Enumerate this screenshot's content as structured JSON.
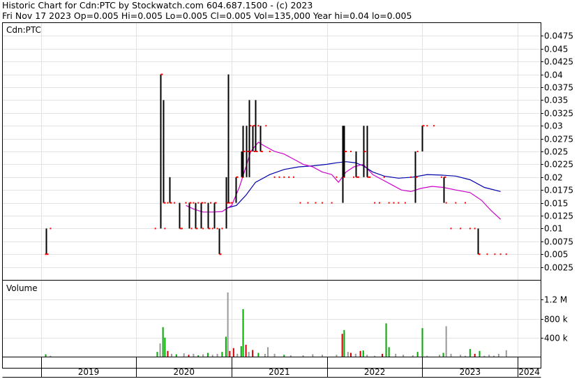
{
  "header": {
    "line1": "Historic Chart for Cdn:PTC by Stockwatch.com 604.687.1500 - (c) 2023",
    "line2": "Fri Nov 17 2023   Op=0.005  Hi=0.005  Lo=0.005  Cl=0.005  Vol=135,000  Year hi=0.04  lo=0.005"
  },
  "chart_data": [
    {
      "type": "line",
      "title": "Cdn:PTC",
      "xlabel": "",
      "ylabel": "",
      "x_tick_labels": [
        "2019",
        "2020",
        "2021",
        "2022",
        "2023",
        "2024"
      ],
      "y_tick_labels": [
        "0.0475",
        "0.045",
        "0.0425",
        "0.04",
        "0.0375",
        "0.035",
        "0.0325",
        "0.03",
        "0.0275",
        "0.025",
        "0.0225",
        "0.02",
        "0.0175",
        "0.015",
        "0.0125",
        "0.01",
        "0.0075",
        "0.005",
        "0.0025"
      ],
      "ylim": [
        0,
        0.05
      ],
      "xlim": [
        2018.6,
        2024.24
      ],
      "grid": true,
      "colors": {
        "price_bar": "#000000",
        "price_close": "#ff0000",
        "ma_short": "#cc00cc",
        "ma_long": "#0000aa"
      },
      "price_bars": [
        [
          2019.05,
          0.005,
          0.01,
          0.005
        ],
        [
          2020.25,
          0.01,
          0.04,
          0.04
        ],
        [
          2020.28,
          0.015,
          0.035,
          0.015
        ],
        [
          2020.35,
          0.015,
          0.02,
          0.015
        ],
        [
          2020.45,
          0.01,
          0.015,
          0.01
        ],
        [
          2020.55,
          0.01,
          0.015,
          0.015
        ],
        [
          2020.62,
          0.01,
          0.015,
          0.01
        ],
        [
          2020.68,
          0.01,
          0.015,
          0.015
        ],
        [
          2020.75,
          0.01,
          0.015,
          0.01
        ],
        [
          2020.82,
          0.01,
          0.015,
          0.015
        ],
        [
          2020.87,
          0.005,
          0.01,
          0.005
        ],
        [
          2020.94,
          0.01,
          0.02,
          0.015
        ],
        [
          2020.96,
          0.015,
          0.04,
          0.015
        ],
        [
          2021.04,
          0.015,
          0.02,
          0.02
        ],
        [
          2021.1,
          0.02,
          0.025,
          0.02
        ],
        [
          2021.12,
          0.02,
          0.03,
          0.025
        ],
        [
          2021.15,
          0.02,
          0.03,
          0.025
        ],
        [
          2021.18,
          0.02,
          0.035,
          0.025
        ],
        [
          2021.22,
          0.025,
          0.03,
          0.03
        ],
        [
          2021.25,
          0.025,
          0.035,
          0.025
        ],
        [
          2021.3,
          0.025,
          0.03,
          0.025
        ],
        [
          2022.16,
          0.015,
          0.03,
          0.02
        ],
        [
          2022.18,
          0.02,
          0.03,
          0.025
        ],
        [
          2022.3,
          0.02,
          0.025,
          0.02
        ],
        [
          2022.38,
          0.02,
          0.03,
          0.025
        ],
        [
          2022.42,
          0.02,
          0.03,
          0.02
        ],
        [
          2022.92,
          0.015,
          0.025,
          0.02
        ],
        [
          2023.0,
          0.025,
          0.03,
          0.03
        ],
        [
          2023.22,
          0.015,
          0.02,
          0.02
        ],
        [
          2023.58,
          0.005,
          0.01,
          0.005
        ]
      ],
      "close_dots": [
        [
          2019.05,
          0.005
        ],
        [
          2019.1,
          0.01
        ],
        [
          2020.2,
          0.01
        ],
        [
          2020.3,
          0.01
        ],
        [
          2020.33,
          0.015
        ],
        [
          2020.4,
          0.015
        ],
        [
          2020.48,
          0.01
        ],
        [
          2020.52,
          0.015
        ],
        [
          2020.58,
          0.01
        ],
        [
          2020.6,
          0.015
        ],
        [
          2020.65,
          0.015
        ],
        [
          2020.7,
          0.01
        ],
        [
          2020.72,
          0.015
        ],
        [
          2020.78,
          0.015
        ],
        [
          2020.8,
          0.01
        ],
        [
          2020.85,
          0.01
        ],
        [
          2020.88,
          0.005
        ],
        [
          2020.9,
          0.01
        ],
        [
          2021.0,
          0.015
        ],
        [
          2021.06,
          0.02
        ],
        [
          2021.13,
          0.025
        ],
        [
          2021.2,
          0.03
        ],
        [
          2021.24,
          0.025
        ],
        [
          2021.28,
          0.03
        ],
        [
          2021.32,
          0.025
        ],
        [
          2021.36,
          0.03
        ],
        [
          2021.4,
          0.025
        ],
        [
          2021.45,
          0.02
        ],
        [
          2021.5,
          0.02
        ],
        [
          2021.55,
          0.02
        ],
        [
          2021.6,
          0.02
        ],
        [
          2021.65,
          0.02
        ],
        [
          2021.72,
          0.015
        ],
        [
          2021.8,
          0.015
        ],
        [
          2021.88,
          0.015
        ],
        [
          2021.95,
          0.015
        ],
        [
          2022.05,
          0.015
        ],
        [
          2022.1,
          0.02
        ],
        [
          2022.2,
          0.025
        ],
        [
          2022.25,
          0.025
        ],
        [
          2022.28,
          0.02
        ],
        [
          2022.33,
          0.02
        ],
        [
          2022.4,
          0.025
        ],
        [
          2022.45,
          0.02
        ],
        [
          2022.5,
          0.015
        ],
        [
          2022.55,
          0.015
        ],
        [
          2022.6,
          0.02
        ],
        [
          2022.65,
          0.015
        ],
        [
          2022.7,
          0.015
        ],
        [
          2022.75,
          0.015
        ],
        [
          2022.82,
          0.015
        ],
        [
          2022.88,
          0.02
        ],
        [
          2022.95,
          0.025
        ],
        [
          2023.05,
          0.03
        ],
        [
          2023.12,
          0.03
        ],
        [
          2023.2,
          0.02
        ],
        [
          2023.25,
          0.015
        ],
        [
          2023.3,
          0.01
        ],
        [
          2023.35,
          0.015
        ],
        [
          2023.4,
          0.01
        ],
        [
          2023.45,
          0.015
        ],
        [
          2023.5,
          0.01
        ],
        [
          2023.55,
          0.01
        ],
        [
          2023.6,
          0.005
        ],
        [
          2023.68,
          0.005
        ],
        [
          2023.76,
          0.005
        ],
        [
          2023.82,
          0.005
        ],
        [
          2023.88,
          0.005
        ]
      ],
      "ma_short": [
        [
          2020.52,
          0.0145
        ],
        [
          2020.6,
          0.0138
        ],
        [
          2020.7,
          0.0132
        ],
        [
          2020.8,
          0.0132
        ],
        [
          2020.9,
          0.0133
        ],
        [
          2021.0,
          0.0145
        ],
        [
          2021.08,
          0.018
        ],
        [
          2021.15,
          0.022
        ],
        [
          2021.2,
          0.025
        ],
        [
          2021.28,
          0.0268
        ],
        [
          2021.35,
          0.026
        ],
        [
          2021.45,
          0.025
        ],
        [
          2021.55,
          0.0245
        ],
        [
          2021.65,
          0.0235
        ],
        [
          2021.75,
          0.0225
        ],
        [
          2021.85,
          0.022
        ],
        [
          2021.95,
          0.021
        ],
        [
          2022.05,
          0.0205
        ],
        [
          2022.12,
          0.019
        ],
        [
          2022.2,
          0.021
        ],
        [
          2022.28,
          0.022
        ],
        [
          2022.38,
          0.0225
        ],
        [
          2022.48,
          0.0205
        ],
        [
          2022.58,
          0.0195
        ],
        [
          2022.68,
          0.0185
        ],
        [
          2022.78,
          0.0175
        ],
        [
          2022.88,
          0.0172
        ],
        [
          2022.98,
          0.0178
        ],
        [
          2023.1,
          0.0182
        ],
        [
          2023.22,
          0.018
        ],
        [
          2023.35,
          0.0175
        ],
        [
          2023.5,
          0.017
        ],
        [
          2023.62,
          0.0155
        ],
        [
          2023.72,
          0.0135
        ],
        [
          2023.82,
          0.0118
        ]
      ],
      "ma_long": [
        [
          2020.95,
          0.014
        ],
        [
          2021.05,
          0.0145
        ],
        [
          2021.15,
          0.0165
        ],
        [
          2021.25,
          0.019
        ],
        [
          2021.4,
          0.0205
        ],
        [
          2021.55,
          0.0215
        ],
        [
          2021.7,
          0.022
        ],
        [
          2021.85,
          0.0222
        ],
        [
          2022.0,
          0.0225
        ],
        [
          2022.1,
          0.0228
        ],
        [
          2022.2,
          0.023
        ],
        [
          2022.3,
          0.0228
        ],
        [
          2022.38,
          0.0222
        ],
        [
          2022.48,
          0.021
        ],
        [
          2022.6,
          0.0202
        ],
        [
          2022.75,
          0.0198
        ],
        [
          2022.9,
          0.02
        ],
        [
          2023.05,
          0.0205
        ],
        [
          2023.2,
          0.0204
        ],
        [
          2023.35,
          0.0202
        ],
        [
          2023.5,
          0.0195
        ],
        [
          2023.65,
          0.018
        ],
        [
          2023.82,
          0.0172
        ]
      ]
    },
    {
      "type": "bar",
      "title": "Volume",
      "xlabel": "",
      "ylabel": "",
      "y_tick_labels": [
        "1.2 M",
        "800 k",
        "400 k"
      ],
      "ylim": [
        0,
        1600000
      ],
      "xlim": [
        2018.6,
        2024.24
      ],
      "colors": {
        "up": "#00aa00",
        "down": "#cc0000",
        "flat": "#999999"
      },
      "bars": [
        [
          2019.05,
          50000,
          "up"
        ],
        [
          2019.1,
          20000,
          "flat"
        ],
        [
          2020.22,
          100000,
          "up"
        ],
        [
          2020.25,
          280000,
          "flat"
        ],
        [
          2020.28,
          620000,
          "up"
        ],
        [
          2020.3,
          400000,
          "up"
        ],
        [
          2020.33,
          120000,
          "down"
        ],
        [
          2020.37,
          60000,
          "flat"
        ],
        [
          2020.42,
          50000,
          "up"
        ],
        [
          2020.5,
          70000,
          "flat"
        ],
        [
          2020.55,
          40000,
          "down"
        ],
        [
          2020.6,
          60000,
          "flat"
        ],
        [
          2020.65,
          30000,
          "up"
        ],
        [
          2020.7,
          50000,
          "flat"
        ],
        [
          2020.75,
          80000,
          "up"
        ],
        [
          2020.8,
          40000,
          "flat"
        ],
        [
          2020.85,
          60000,
          "flat"
        ],
        [
          2020.9,
          100000,
          "up"
        ],
        [
          2020.94,
          420000,
          "up"
        ],
        [
          2020.96,
          1350000,
          "flat"
        ],
        [
          2020.98,
          120000,
          "down"
        ],
        [
          2021.02,
          180000,
          "down"
        ],
        [
          2021.06,
          60000,
          "flat"
        ],
        [
          2021.1,
          220000,
          "up"
        ],
        [
          2021.12,
          1000000,
          "up"
        ],
        [
          2021.15,
          250000,
          "down"
        ],
        [
          2021.18,
          100000,
          "flat"
        ],
        [
          2021.22,
          140000,
          "down"
        ],
        [
          2021.28,
          80000,
          "up"
        ],
        [
          2021.35,
          60000,
          "flat"
        ],
        [
          2021.38,
          200000,
          "flat"
        ],
        [
          2021.45,
          60000,
          "flat"
        ],
        [
          2021.55,
          40000,
          "up"
        ],
        [
          2021.62,
          30000,
          "flat"
        ],
        [
          2021.75,
          30000,
          "flat"
        ],
        [
          2021.85,
          50000,
          "flat"
        ],
        [
          2021.95,
          40000,
          "flat"
        ],
        [
          2022.1,
          40000,
          "flat"
        ],
        [
          2022.16,
          480000,
          "down"
        ],
        [
          2022.18,
          560000,
          "up"
        ],
        [
          2022.22,
          100000,
          "flat"
        ],
        [
          2022.25,
          80000,
          "down"
        ],
        [
          2022.3,
          60000,
          "flat"
        ],
        [
          2022.35,
          120000,
          "down"
        ],
        [
          2022.38,
          130000,
          "up"
        ],
        [
          2022.42,
          40000,
          "flat"
        ],
        [
          2022.5,
          20000,
          "flat"
        ],
        [
          2022.58,
          60000,
          "down"
        ],
        [
          2022.62,
          700000,
          "up"
        ],
        [
          2022.65,
          200000,
          "up"
        ],
        [
          2022.72,
          60000,
          "flat"
        ],
        [
          2022.8,
          40000,
          "flat"
        ],
        [
          2022.9,
          30000,
          "flat"
        ],
        [
          2022.95,
          100000,
          "up"
        ],
        [
          2023.0,
          600000,
          "up"
        ],
        [
          2023.05,
          20000,
          "flat"
        ],
        [
          2023.18,
          40000,
          "flat"
        ],
        [
          2023.22,
          80000,
          "up"
        ],
        [
          2023.25,
          640000,
          "flat"
        ],
        [
          2023.3,
          60000,
          "flat"
        ],
        [
          2023.4,
          40000,
          "flat"
        ],
        [
          2023.45,
          20000,
          "flat"
        ],
        [
          2023.5,
          160000,
          "up"
        ],
        [
          2023.55,
          60000,
          "down"
        ],
        [
          2023.6,
          120000,
          "up"
        ],
        [
          2023.65,
          20000,
          "flat"
        ],
        [
          2023.7,
          40000,
          "flat"
        ],
        [
          2023.75,
          20000,
          "flat"
        ],
        [
          2023.8,
          60000,
          "flat"
        ],
        [
          2023.88,
          135000,
          "flat"
        ]
      ]
    }
  ]
}
